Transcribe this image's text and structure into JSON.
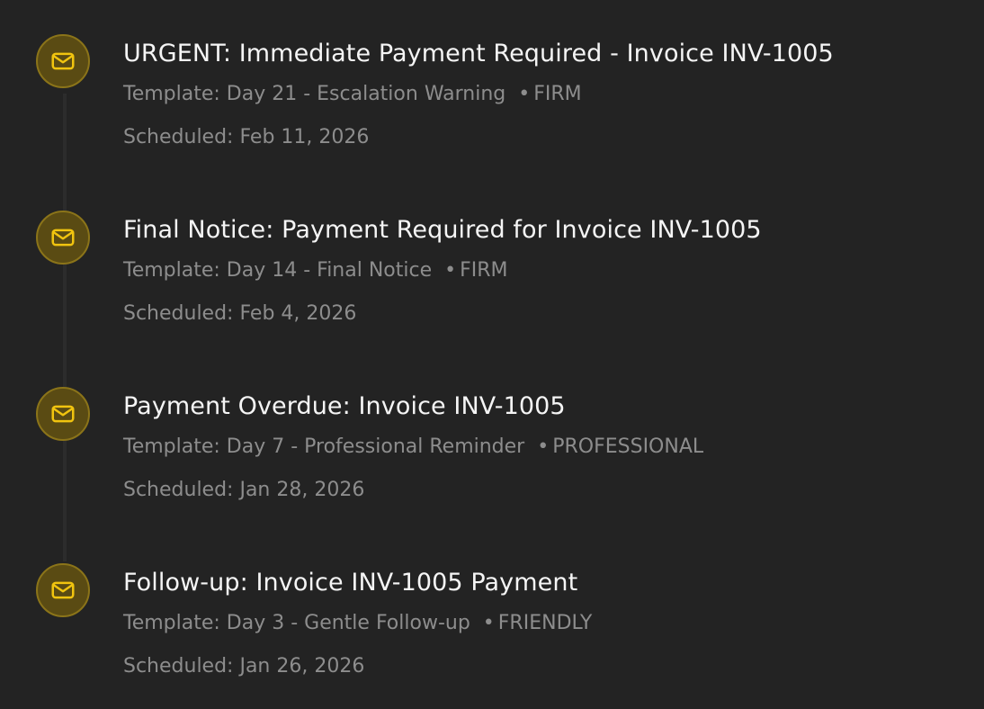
{
  "colors": {
    "background": "#232323",
    "icon_fill": "#5a4b13",
    "icon_border": "#8b7419",
    "icon_stroke": "#f1c40f",
    "title_text": "#f5f5f5",
    "meta_text": "#8d8d8d"
  },
  "items": [
    {
      "icon": "mail-icon",
      "title": "URGENT: Immediate Payment Required - Invoice INV-1005",
      "template": "Template: Day 21 - Escalation Warning",
      "tone": "FIRM",
      "scheduled": "Scheduled: Feb 11, 2026"
    },
    {
      "icon": "mail-icon",
      "title": "Final Notice: Payment Required for Invoice INV-1005",
      "template": "Template: Day 14 - Final Notice",
      "tone": "FIRM",
      "scheduled": "Scheduled: Feb 4, 2026"
    },
    {
      "icon": "mail-icon",
      "title": "Payment Overdue: Invoice INV-1005",
      "template": "Template: Day 7 - Professional Reminder",
      "tone": "PROFESSIONAL",
      "scheduled": "Scheduled: Jan 28, 2026"
    },
    {
      "icon": "mail-icon",
      "title": "Follow-up: Invoice INV-1005 Payment",
      "template": "Template: Day 3 - Gentle Follow-up",
      "tone": "FRIENDLY",
      "scheduled": "Scheduled: Jan 26, 2026"
    }
  ]
}
